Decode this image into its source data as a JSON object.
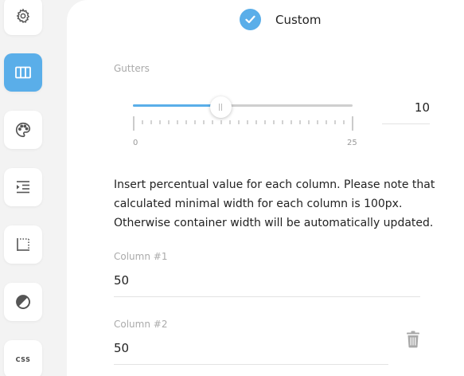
{
  "sidebar": {
    "items": [
      {
        "icon": "gear-icon",
        "active": false
      },
      {
        "icon": "columns-icon",
        "active": true
      },
      {
        "icon": "palette-icon",
        "active": false
      },
      {
        "icon": "indent-icon",
        "active": false
      },
      {
        "icon": "border-icon",
        "active": false
      },
      {
        "icon": "contrast-icon",
        "active": false
      },
      {
        "icon": "css-icon",
        "label": "CSS",
        "active": false
      }
    ]
  },
  "layout_option": {
    "label": "Custom",
    "selected": true,
    "icon": "check-icon"
  },
  "gutters": {
    "label": "Gutters",
    "min": "0",
    "max": "25",
    "value": "10",
    "fraction": 0.4
  },
  "info_text": "Insert percentual value for each column. Please note that calculated minimal width for each column is 100px. Otherwise container width will be automatically updated.",
  "columns": [
    {
      "label": "Column #1",
      "value": "50"
    },
    {
      "label": "Column #2",
      "value": "50"
    }
  ],
  "colors": {
    "accent": "#5aaee9",
    "muted_text": "#aaaaaa"
  }
}
